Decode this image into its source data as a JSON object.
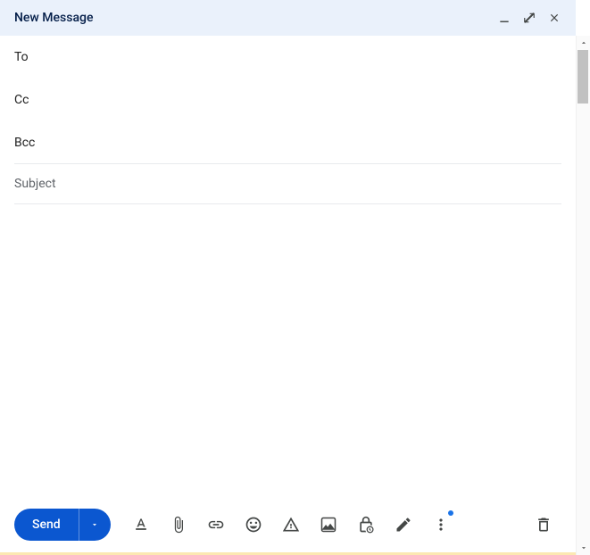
{
  "header": {
    "title": "New Message"
  },
  "fields": {
    "to_label": "To",
    "cc_label": "Cc",
    "bcc_label": "Bcc",
    "subject_placeholder": "Subject"
  },
  "footer": {
    "send_label": "Send"
  }
}
